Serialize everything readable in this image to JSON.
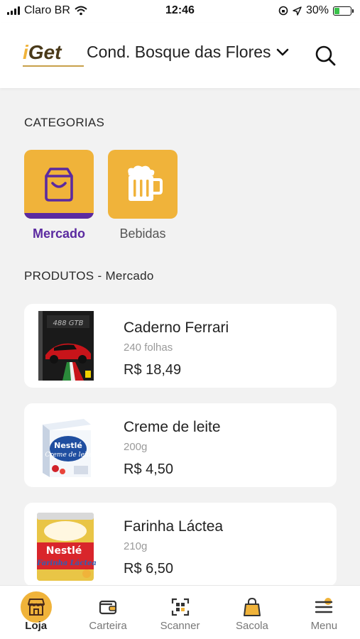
{
  "status_bar": {
    "carrier": "Claro BR",
    "time": "12:46",
    "battery": "30%",
    "battery_level": 0.3,
    "icons": [
      "signal-icon",
      "wifi-icon",
      "orientation-lock-icon",
      "location-arrow-icon",
      "battery-icon"
    ]
  },
  "header": {
    "logo": "iGet",
    "location": "Cond. Bosque das Flores",
    "icons": [
      "chevron-down-icon",
      "search-icon"
    ]
  },
  "categories": {
    "title": "CATEGORIAS",
    "items": [
      {
        "label": "Mercado",
        "icon": "shopping-bag-icon",
        "active": true
      },
      {
        "label": "Bebidas",
        "icon": "beer-mug-icon",
        "active": false
      }
    ]
  },
  "products": {
    "title": "PRODUTOS - Mercado",
    "items": [
      {
        "name": "Caderno Ferrari",
        "desc": "240 folhas",
        "price": "R$ 18,49",
        "image": "notebook-ferrari-image"
      },
      {
        "name": "Creme de leite",
        "desc": "200g",
        "price": "R$ 4,50",
        "image": "cream-box-image"
      },
      {
        "name": "Farinha Láctea",
        "desc": "210g",
        "price": "R$ 6,50",
        "image": "milk-flour-can-image"
      }
    ]
  },
  "nav": {
    "items": [
      {
        "label": "Loja",
        "icon": "store-icon",
        "active": true
      },
      {
        "label": "Carteira",
        "icon": "wallet-icon",
        "active": false
      },
      {
        "label": "Scanner",
        "icon": "qr-scanner-icon",
        "active": false
      },
      {
        "label": "Sacola",
        "icon": "bag-icon",
        "active": false
      },
      {
        "label": "Menu",
        "icon": "menu-icon",
        "active": false
      }
    ]
  },
  "colors": {
    "accent": "#f0b33a",
    "active_purple": "#5b2aa0",
    "background": "#f2f2f2"
  }
}
